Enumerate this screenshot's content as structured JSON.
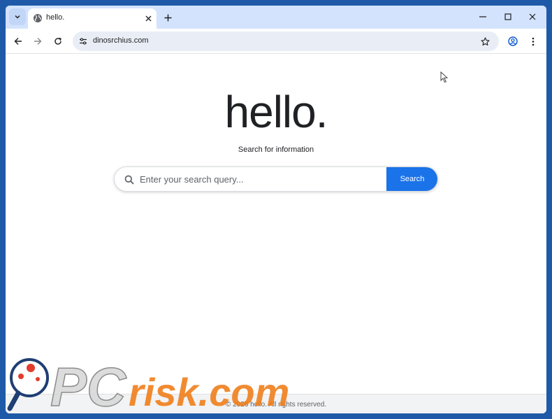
{
  "browser": {
    "tab_title": "hello.",
    "url": "dinosrchius.com"
  },
  "page": {
    "logo": "hello.",
    "tagline": "Search for information",
    "search": {
      "placeholder": "Enter your search query...",
      "button_label": "Search"
    },
    "footer": "© 2026 hello. All rights reserved."
  },
  "watermark": {
    "text": "PCrisk.com"
  },
  "colors": {
    "accent": "#1a73e8",
    "tabstrip": "#d3e3fd",
    "background": "#1f5aa8"
  }
}
